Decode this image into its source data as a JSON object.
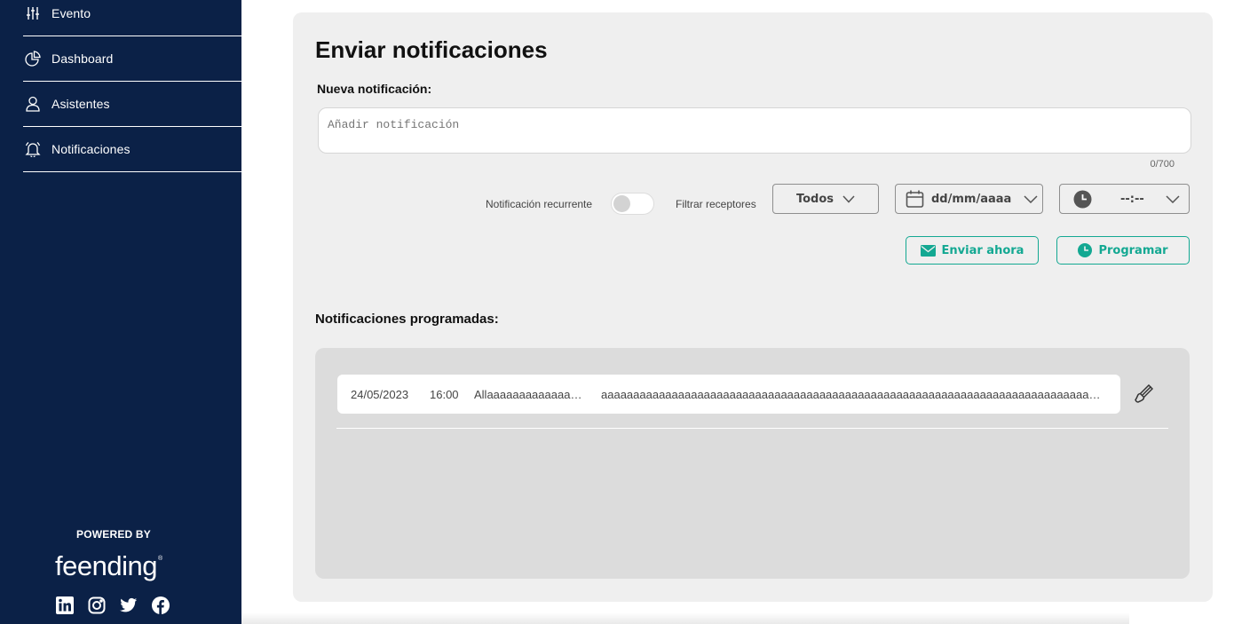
{
  "sidebar": {
    "items": [
      {
        "label": "Evento",
        "icon": "sliders-icon"
      },
      {
        "label": "Dashboard",
        "icon": "pie-chart-icon"
      },
      {
        "label": "Asistentes",
        "icon": "user-icon"
      },
      {
        "label": "Notificaciones",
        "icon": "bell-icon"
      }
    ],
    "powered_by": "POWERED BY",
    "brand": "feending",
    "brand_mark": "®",
    "socials": [
      "linkedin-icon",
      "instagram-icon",
      "twitter-icon",
      "facebook-icon"
    ]
  },
  "main": {
    "title": "Enviar notificaciones",
    "new_label": "Nueva notificación:",
    "placeholder": "Añadir notificación",
    "counter": "0/700",
    "recurrent_label": "Notificación recurrente",
    "recurrent_on": false,
    "filter_label": "Filtrar receptores",
    "receivers": "Todos",
    "date": "dd/mm/aaaa",
    "time": "--:--",
    "send_now": "Enviar ahora",
    "schedule": "Programar",
    "scheduled_title": "Notificaciones programadas:",
    "scheduled": [
      {
        "date": "24/05/2023",
        "time": "16:00",
        "title": "Allaaaaaaaaaaaaaaaaaaaaa",
        "message": "aaaaaaaaaaaaaaaaaaaaaaaaaaaaaaaaaaaaaaaaaaaaaaaaaaaaaaaaaaaaaaaaaaaaaaaaaaaaaaaaaaaaaaaaaaaaaaaaaaaaaaaaaaaa"
      }
    ]
  },
  "colors": {
    "sidebar": "#0b2147",
    "accent": "#13a892",
    "panel": "#efefef",
    "list": "#dcdcdc"
  }
}
